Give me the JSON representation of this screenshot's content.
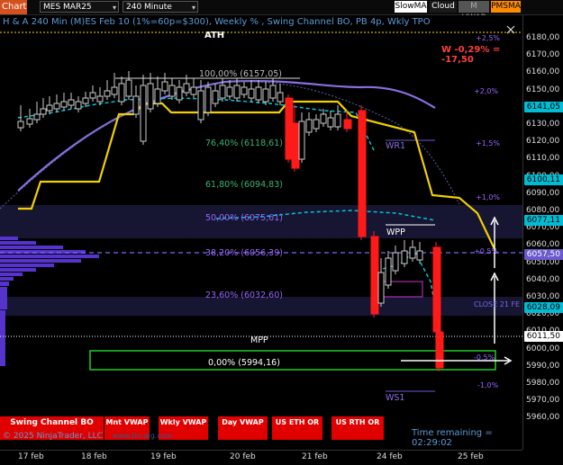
{
  "toolbar": {
    "chart_tab": "Chart",
    "instrument": "MES MAR25",
    "interval": "240 Minute",
    "buttons": [
      {
        "label": "SlowMA",
        "bg": "#ffffff",
        "fg": "#000000"
      },
      {
        "label": "Cloud",
        "bg": "#1a1a1a",
        "fg": "#ffffff"
      },
      {
        "label": "M VWAP",
        "bg": "#555555",
        "fg": "#aaaaaa"
      },
      {
        "label": "PMSMA",
        "bg": "#ff8c00",
        "fg": "#000000"
      }
    ]
  },
  "chart": {
    "title": "H & A 240 Min (M)ES Feb 10  (1%=60p=$300), Weekly % , Swing Channel BO, PB 4p, Wkly TPO",
    "ath_label": "ATH",
    "w_label": "W -0,29% = -17,50",
    "fib_labels": [
      {
        "text": "100,00% (6157,05)",
        "color": "#bbbbbb"
      },
      {
        "text": "76,40% (6118,61)",
        "color": "#3cb371"
      },
      {
        "text": "61,80% (6094,83)",
        "color": "#3cb371"
      },
      {
        "text": "50,00% (6075,61)",
        "color": "#9966ff"
      },
      {
        "text": "38,20% (6056,39)",
        "color": "#9966ff"
      },
      {
        "text": "23,60% (6032,60)",
        "color": "#9966ff"
      },
      {
        "text": "0,00% (5994,16)",
        "color": "#ffffff"
      }
    ],
    "level_labels": {
      "wr1": "WR1",
      "wpp": "WPP",
      "ws1": "WS1",
      "mpp": "MPP",
      "close": "CLOSE 21 FE"
    },
    "pct_labels": [
      "+2,5%",
      "+2,0%",
      "+1,5%",
      "+1,0%",
      "+0,5%",
      "-0,5%",
      "-1,0%"
    ],
    "time_remaining": "Time remaining = 02:29:02",
    "copyright": "© 2025 NinjaTrader, LLC",
    "watermark": "www.tin-alg.com"
  },
  "chart_data": {
    "type": "line",
    "yaxis_ticks": [
      "6180,00",
      "6170,00",
      "6160,00",
      "6150,00",
      "6140,00",
      "6130,00",
      "6120,00",
      "6110,00",
      "6100,00",
      "6090,00",
      "6080,00",
      "6070,00",
      "6060,00",
      "6050,00",
      "6040,00",
      "6030,00",
      "6020,00",
      "6010,00",
      "6000,00",
      "5990,00",
      "5980,00",
      "5970,00",
      "5960,00"
    ],
    "price_badges": [
      {
        "value": "6141,05",
        "bg": "#00bcd4",
        "fg": "#000000"
      },
      {
        "value": "6100,11",
        "bg": "#00bcd4",
        "fg": "#000000"
      },
      {
        "value": "6077,11",
        "bg": "#00bcd4",
        "fg": "#000000"
      },
      {
        "value": "6057,50",
        "bg": "#6a5acd",
        "fg": "#ffffff"
      },
      {
        "value": "6028,09",
        "bg": "#00bcd4",
        "fg": "#000000"
      },
      {
        "value": "6011,50",
        "bg": "#ffffff",
        "fg": "#000000"
      }
    ],
    "xaxis_ticks": [
      "17 feb",
      "18 feb",
      "19 feb",
      "20 feb",
      "21 feb",
      "24 feb",
      "25 feb"
    ]
  },
  "bottom_buttons": [
    {
      "label": "Swing Channel BO"
    },
    {
      "label": "Mnt VWAP"
    },
    {
      "label": "Wkly VWAP"
    },
    {
      "label": "Day VWAP"
    },
    {
      "label": "US ETH OR"
    },
    {
      "label": "US RTH OR"
    }
  ]
}
